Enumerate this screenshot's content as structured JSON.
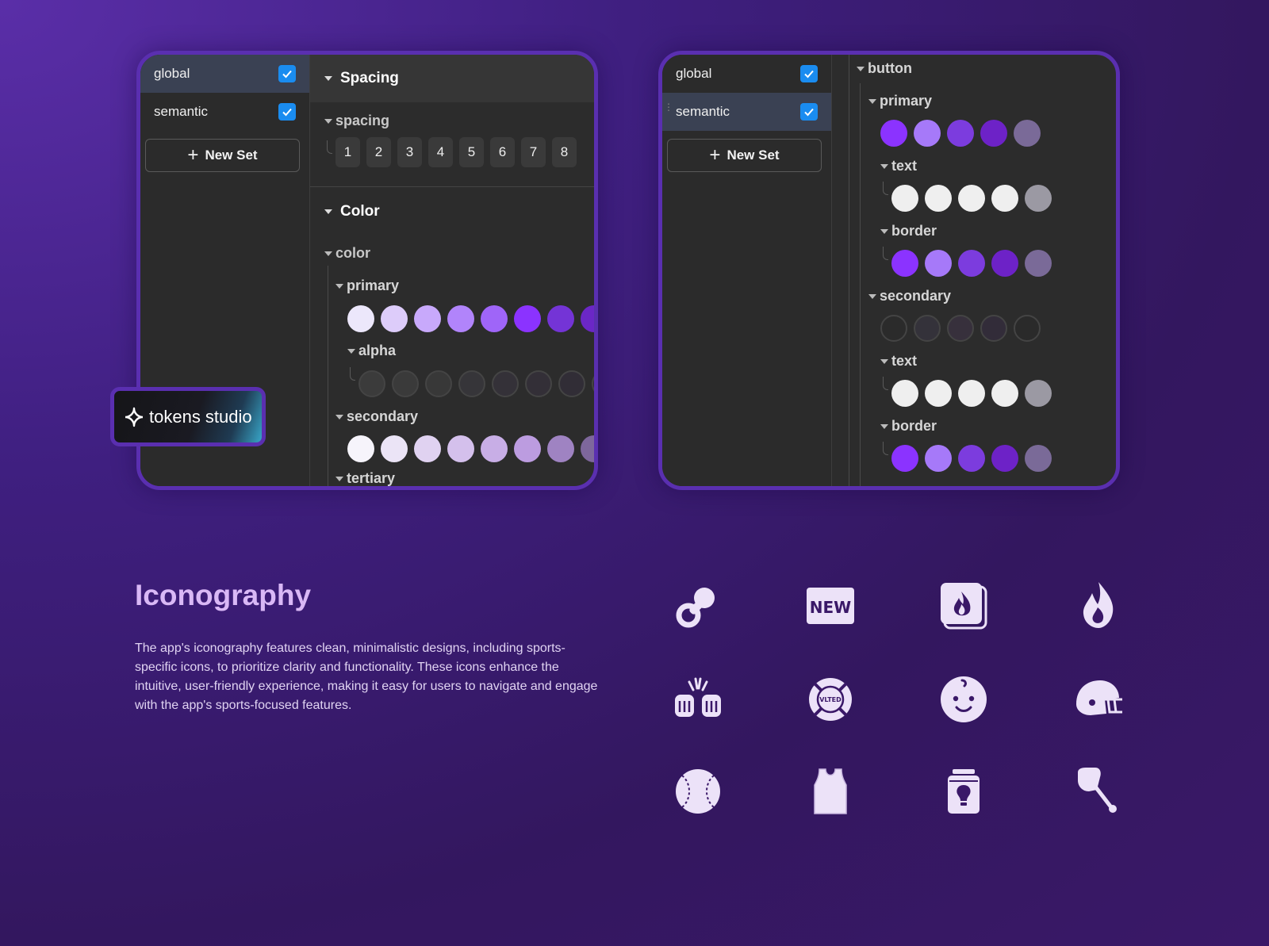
{
  "left_panel": {
    "sets": [
      {
        "label": "global",
        "checked": true,
        "active": true
      },
      {
        "label": "semantic",
        "checked": true,
        "active": false
      }
    ],
    "new_set_label": "New Set",
    "spacing_header": "Spacing",
    "spacing_group": "spacing",
    "spacing_values": [
      "1",
      "2",
      "3",
      "4",
      "5",
      "6",
      "7",
      "8"
    ],
    "color_header": "Color",
    "color_group": "color",
    "primary_label": "primary",
    "primary_colors": [
      "#ece7fb",
      "#ddccfa",
      "#c8a9fb",
      "#b184fb",
      "#9f65f8",
      "#8b33ff",
      "#7434d6",
      "#6b27c6"
    ],
    "alpha_label": "alpha",
    "alpha_colors": [
      "#3b3b3b",
      "#3a3a3a",
      "#383838",
      "#363539",
      "#343138",
      "#332f37",
      "#312d36",
      "#2f2c34"
    ],
    "secondary_label": "secondary",
    "secondary_colors": [
      "#f6f4fb",
      "#ebe4f6",
      "#e0d2f1",
      "#d4c0ec",
      "#c8aee6",
      "#bc9ce0",
      "#9f83c2",
      "#7e679c"
    ],
    "tertiary_label": "tertiary"
  },
  "right_panel": {
    "sets": [
      {
        "label": "global",
        "checked": true,
        "active": false
      },
      {
        "label": "semantic",
        "checked": true,
        "active": true
      }
    ],
    "new_set_label": "New Set",
    "button_label": "button",
    "primary_label": "primary",
    "primary_colors": [
      "#8b33ff",
      "#a679f9",
      "#7c3cde",
      "#6d22c7",
      "#7a6a98"
    ],
    "text_label": "text",
    "text_colors": [
      "#efefef",
      "#efefef",
      "#efefef",
      "#efefef",
      "#9b99a3"
    ],
    "border_label": "border",
    "border_colors": [
      "#8b33ff",
      "#a679f9",
      "#7c3cde",
      "#6d22c7",
      "#7a6a98"
    ],
    "secondary_label": "secondary",
    "secondary_colors": [
      "#2b2b2b",
      "#34323a",
      "#37303c",
      "#322c39",
      "#2a2a2a"
    ],
    "text2_label": "text",
    "text2_colors": [
      "#efefef",
      "#efefef",
      "#efefef",
      "#efefef",
      "#9b99a3"
    ],
    "border2_label": "border",
    "border2_colors": [
      "#8b33ff",
      "#a679f9",
      "#7c3cde",
      "#6d22c7",
      "#7a6a98"
    ]
  },
  "badge": {
    "text": "tokens studio"
  },
  "iconography": {
    "title": "Iconography",
    "description": "The app's iconography features clean, minimalistic designs, including sports-specific icons, to prioritize clarity and functionality. These icons enhance the intuitive, user-friendly experience, making it easy for users to navigate and engage with the app's sports-focused features.",
    "new_badge_text": "NEW",
    "vlted_text": "VLTED",
    "icon_color": "#ece2f8",
    "icons": [
      "pacifier-icon",
      "new-badge-icon",
      "fire-card-icon",
      "fire-icon",
      "hands-clapping-icon",
      "vlted-shield-icon",
      "baby-face-icon",
      "football-helmet-icon",
      "baseball-icon",
      "jersey-icon",
      "lightbulb-jar-icon",
      "drumstick-icon"
    ]
  }
}
